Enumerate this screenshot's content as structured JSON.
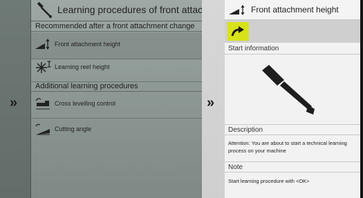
{
  "left_panel": {
    "title": "Learning procedures of front attachmen",
    "section_recommended": "Recommended after a front attachment change",
    "section_additional": "Additional learning procedures",
    "items": [
      {
        "label": "Front attachment height",
        "icon": "front-attachment-height-icon",
        "selected": true
      },
      {
        "label": "Learning reel height",
        "icon": "reel-height-icon",
        "selected": false
      },
      {
        "label": "Cross levelling control",
        "icon": "cross-levelling-icon",
        "selected": false
      },
      {
        "label": "Cutting angle",
        "icon": "cutting-angle-icon",
        "selected": false
      }
    ],
    "expand_glyph": "»"
  },
  "middle": {
    "expand_glyph": "»"
  },
  "right_panel": {
    "title": "Front attachment height",
    "next_button_icon": "arrow-right-icon",
    "start_information_label": "Start information",
    "description_label": "Description",
    "description_text": "Attention: You are about to start a technical learning process on your machine",
    "note_label": "Note",
    "note_text": "Start learning procedure with <OK>"
  },
  "colors": {
    "accent_yellow": "#d8e21a",
    "left_panel_bg": "#8f9a96",
    "right_panel_bg": "#f2f2f2"
  }
}
